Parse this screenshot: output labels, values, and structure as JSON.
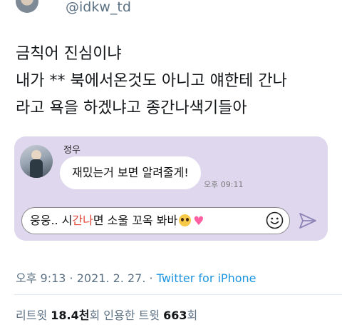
{
  "author": {
    "handle": "@idkw_td"
  },
  "tweet": {
    "lines": [
      "금칙어 진심이냐",
      "내가 ** 북에서온것도 아니고 얘한테 간나",
      "라고 욕을 하겠냐고 종간나색기들아"
    ]
  },
  "embedded_chat": {
    "sender_name": "정우",
    "message": "재밌는거 보면 알려줄게!",
    "message_time": "오후 09:11",
    "input": {
      "text_before": "웅웅.. 시",
      "text_highlight": "간나",
      "text_after": "면 소울 꼬옥 봐바",
      "emoji_1": "pleading-face-emoji",
      "emoji_2": "pink-heart-emoji"
    },
    "icons": {
      "emoji_button": "smiley-icon",
      "send_button": "send-icon"
    },
    "colors": {
      "card_bg": "#ded7ee",
      "highlight": "#e0463b"
    }
  },
  "meta": {
    "time": "오후 9:13",
    "date": "2021. 2. 27.",
    "source": "Twitter for iPhone"
  },
  "stats": {
    "retweets_label": "리트윗",
    "retweets_value": "18.4천",
    "retweets_unit": "회",
    "quotes_label": "인용한 트윗",
    "quotes_value": "663",
    "quotes_unit": "회"
  },
  "colors": {
    "link": "#1b95e0",
    "secondary_text": "#5b7083"
  }
}
